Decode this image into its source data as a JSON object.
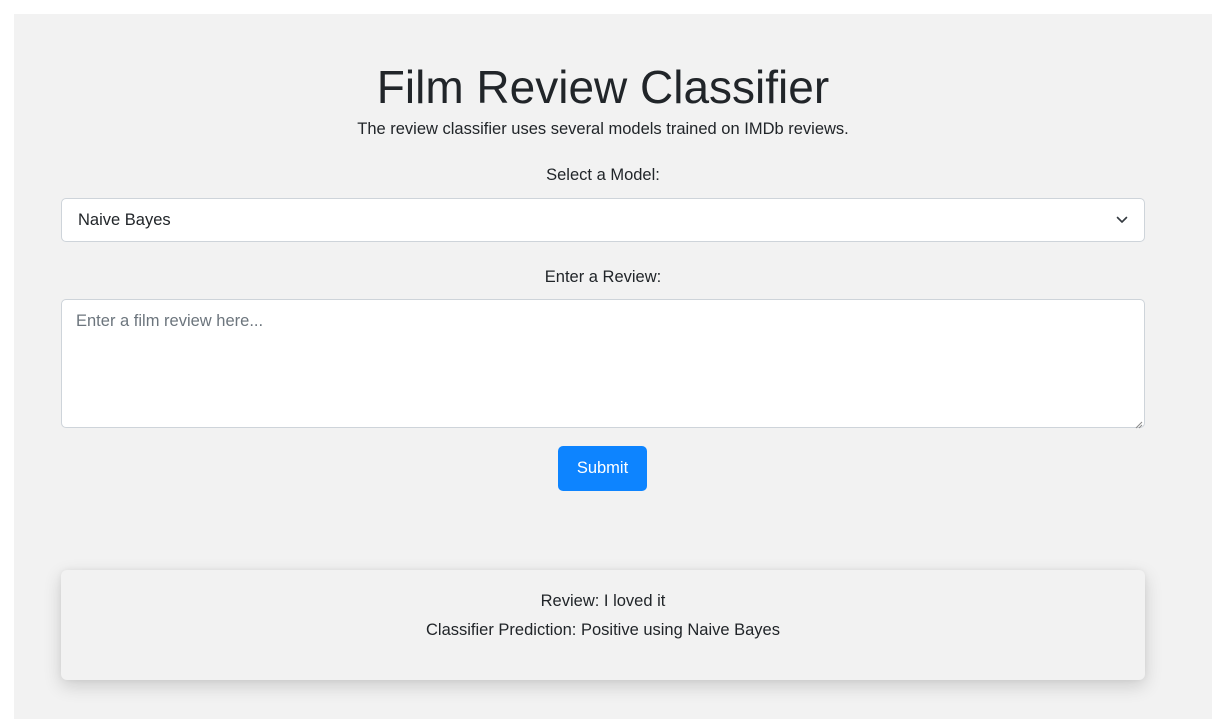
{
  "header": {
    "title": "Film Review Classifier",
    "subtitle": "The review classifier uses several models trained on IMDb reviews."
  },
  "model_select": {
    "label": "Select a Model:",
    "selected": "Naive Bayes",
    "icon": "chevron-down-icon"
  },
  "review_input": {
    "label": "Enter a Review:",
    "value": "",
    "placeholder": "Enter a film review here..."
  },
  "form": {
    "submit_label": "Submit"
  },
  "result": {
    "review_text": "Review: I loved it",
    "prediction_text": "Classifier Prediction: Positive using Naive Bayes"
  },
  "colors": {
    "background": "#f2f2f2",
    "accent": "#0d84ff",
    "text": "#212529",
    "border": "#ced4da"
  }
}
